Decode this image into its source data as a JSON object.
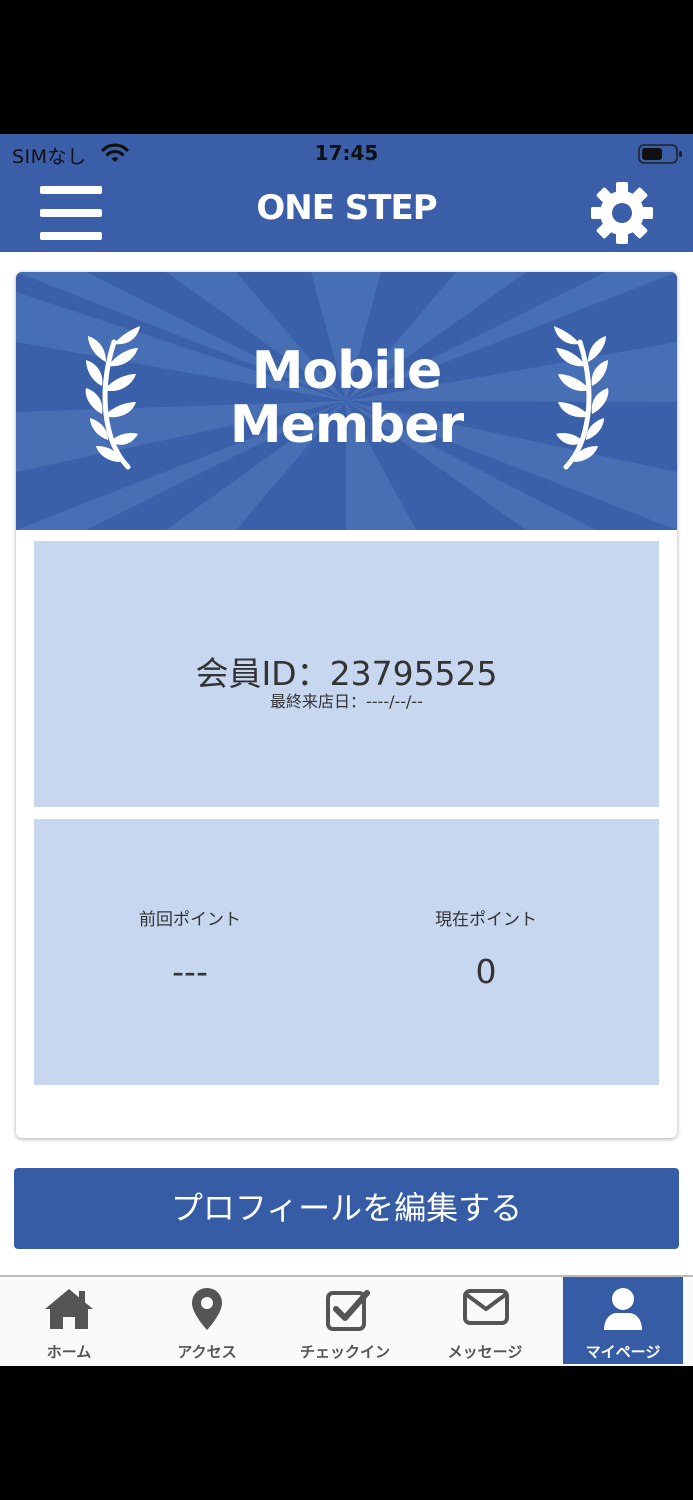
{
  "status_bar": {
    "carrier": "SIMなし",
    "time": "17:45"
  },
  "header": {
    "title": "ONE STEP"
  },
  "banner": {
    "line1": "Mobile",
    "line2": "Member"
  },
  "member": {
    "id_text": "会員ID：23795525",
    "last_visit": "最終来店日：----/--/--"
  },
  "points": {
    "previous_label": "前回ポイント",
    "previous_value": "---",
    "current_label": "現在ポイント",
    "current_value": "0"
  },
  "edit_profile_label": "プロフィールを編集する",
  "tabs": [
    {
      "label": "ホーム",
      "icon": "home-icon"
    },
    {
      "label": "アクセス",
      "icon": "map-pin-icon"
    },
    {
      "label": "チェックイン",
      "icon": "checkbox-icon"
    },
    {
      "label": "メッセージ",
      "icon": "envelope-icon"
    },
    {
      "label": "マイページ",
      "icon": "user-icon",
      "active": true
    }
  ],
  "colors": {
    "primary": "#3b5ea8",
    "panel": "#c7d7f0",
    "tab_active": "#355ca5"
  }
}
